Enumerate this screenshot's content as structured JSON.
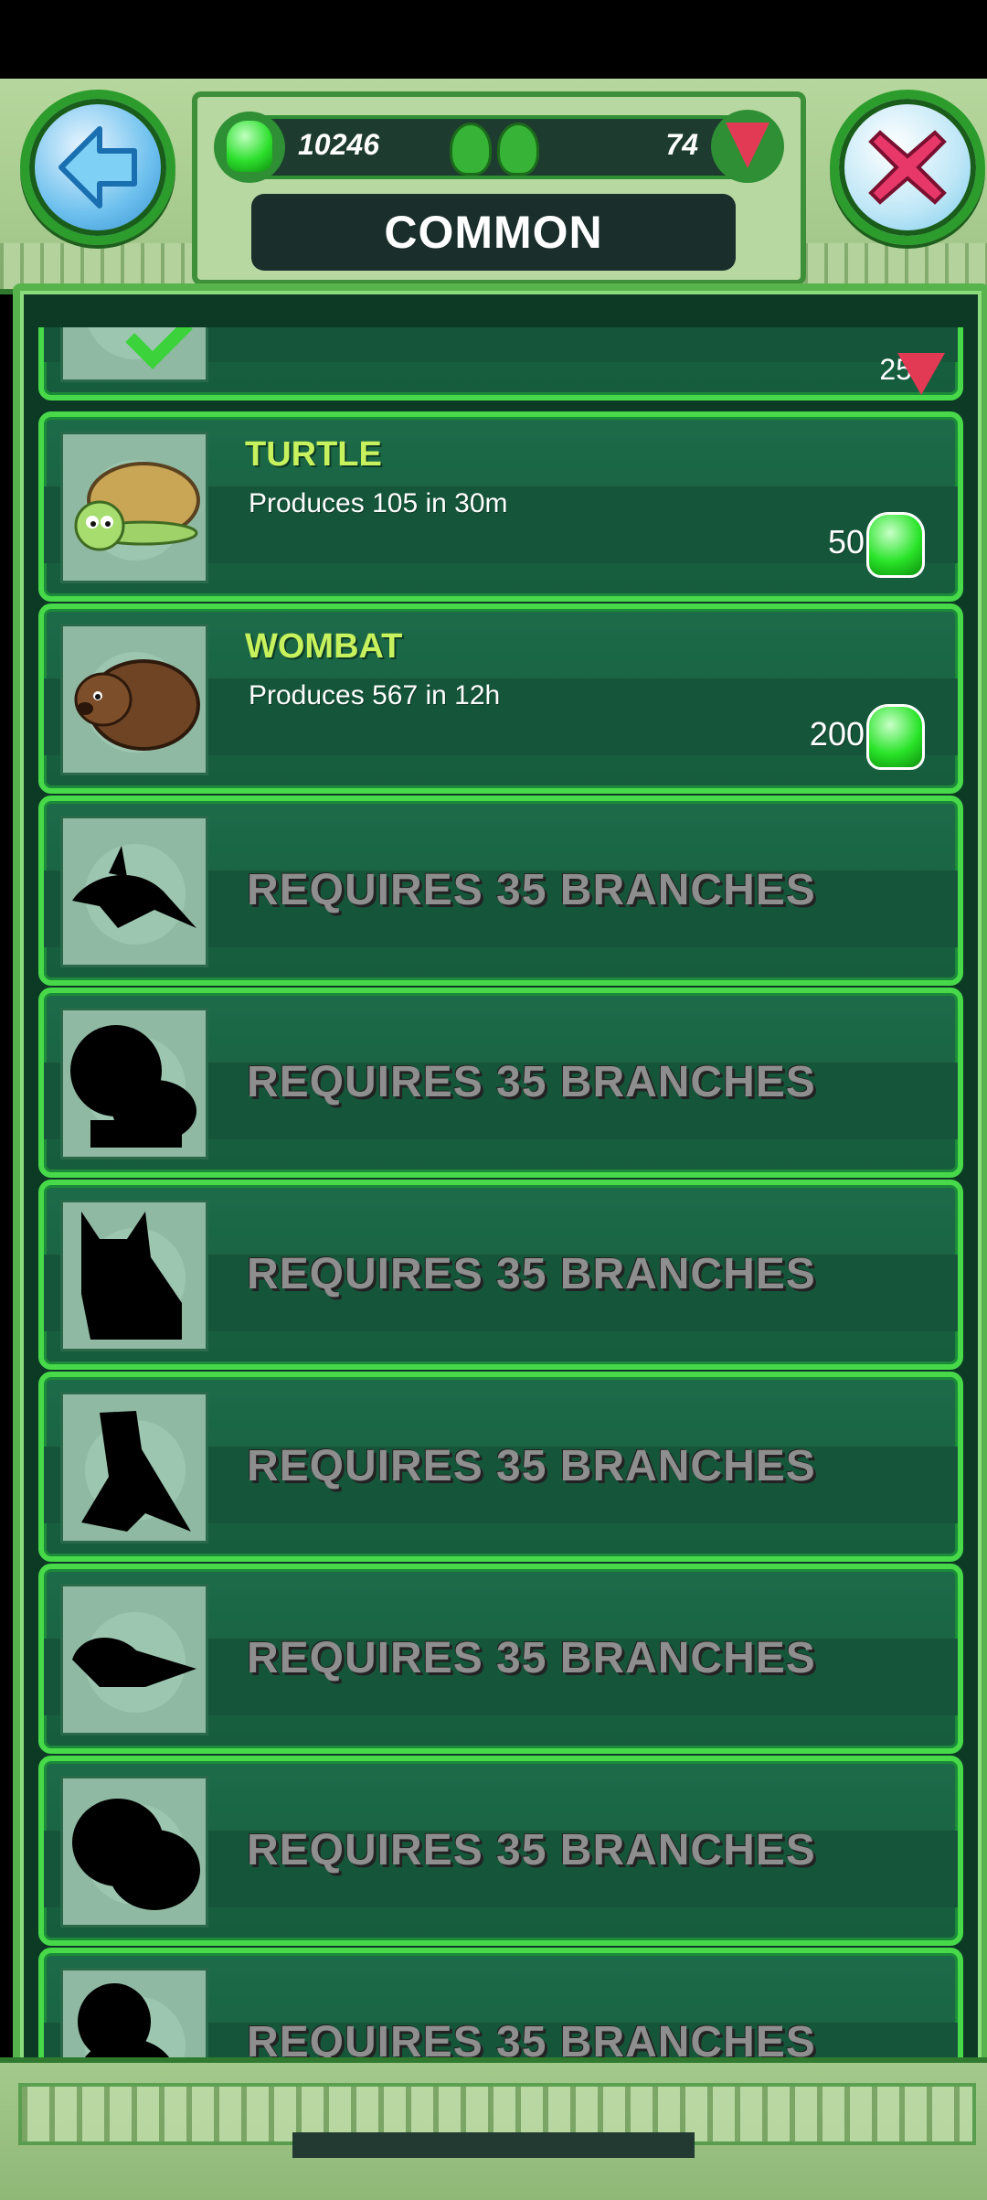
{
  "header": {
    "title": "COMMON",
    "gems": "10246",
    "crystals": "74"
  },
  "list": {
    "top_partial": {
      "price": "25"
    },
    "unlocked": [
      {
        "name": "TURTLE",
        "description": "Produces 105 in 30m",
        "price": "50"
      },
      {
        "name": "WOMBAT",
        "description": "Produces 567 in 12h",
        "price": "200"
      }
    ],
    "locked": [
      {
        "requirement": "REQUIRES 35 BRANCHES"
      },
      {
        "requirement": "REQUIRES 35 BRANCHES"
      },
      {
        "requirement": "REQUIRES 35 BRANCHES"
      },
      {
        "requirement": "REQUIRES 35 BRANCHES"
      },
      {
        "requirement": "REQUIRES 35 BRANCHES"
      },
      {
        "requirement": "REQUIRES 35 BRANCHES"
      },
      {
        "requirement": "REQUIRES 35 BRANCHES"
      }
    ]
  },
  "icons": {
    "back": "back-arrow-icon",
    "close": "close-x-icon",
    "gem": "green-gem-icon",
    "crystal": "red-crystal-icon"
  }
}
